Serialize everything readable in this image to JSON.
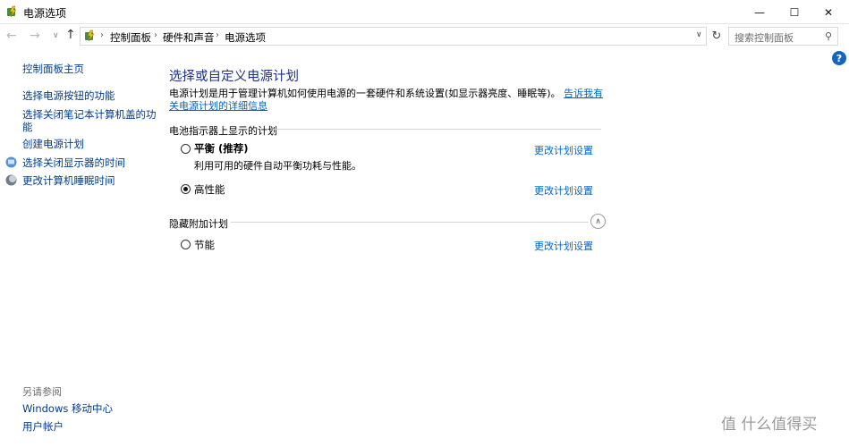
{
  "window": {
    "title": "电源选项",
    "minimize_glyph": "—",
    "maximize_glyph": "☐",
    "close_glyph": "✕"
  },
  "nav": {
    "back_glyph": "←",
    "forward_glyph": "→",
    "recent_glyph": "∨",
    "up_glyph": "↑",
    "refresh_glyph": "↻",
    "dropdown_glyph": "∨",
    "breadcrumbs": [
      "控制面板",
      "硬件和声音",
      "电源选项"
    ],
    "crumb_sep": "›",
    "search_placeholder": "搜索控制面板",
    "search_glyph": "⚲"
  },
  "sidebar": {
    "home": "控制面板主页",
    "items": [
      "选择电源按钮的功能",
      "选择关闭笔记本计算机盖的功",
      "能",
      "创建电源计划",
      "选择关闭显示器的时间",
      "更改计算机睡眠时间"
    ],
    "see_also_title": "另请参阅",
    "see_also": [
      "Windows 移动中心",
      "用户帐户"
    ]
  },
  "main": {
    "title": "选择或自定义电源计划",
    "description": "电源计划是用于管理计算机如何使用电源的一套硬件和系统设置(如显示器亮度、睡眠等)。",
    "description_link": "告诉我有关电源计划的详细信息",
    "battery_group_title": "电池指示器上显示的计划",
    "hidden_group_title": "隐藏附加计划",
    "plans": [
      {
        "name": "平衡 (推荐)",
        "desc": "利用可用的硬件自动平衡功耗与性能。",
        "selected": false,
        "link": "更改计划设置"
      },
      {
        "name": "高性能",
        "desc": "",
        "selected": true,
        "link": "更改计划设置"
      },
      {
        "name": "节能",
        "desc": "",
        "selected": false,
        "link": "更改计划设置"
      }
    ],
    "collapse_glyph": "∧"
  },
  "help": {
    "glyph": "?"
  },
  "watermark": {
    "text": "值 什么值得买"
  },
  "colors": {
    "link": "#0066cc",
    "title": "#1e3287",
    "sidebar_link": "#003c8e",
    "help_blue": "#1565c0"
  },
  "icons": [
    "power-options-icon",
    "back-arrow-icon",
    "forward-arrow-icon",
    "up-arrow-icon",
    "refresh-icon",
    "search-icon",
    "help-icon",
    "monitor-icon",
    "moon-icon",
    "collapse-chevron-icon"
  ]
}
